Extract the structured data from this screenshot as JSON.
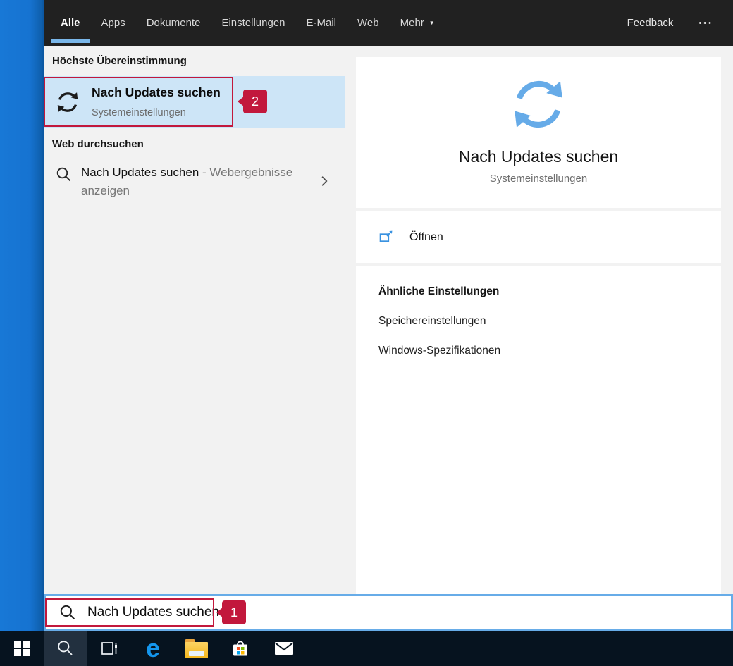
{
  "topbar": {
    "tabs": [
      {
        "label": "Alle",
        "active": true
      },
      {
        "label": "Apps"
      },
      {
        "label": "Dokumente"
      },
      {
        "label": "Einstellungen"
      },
      {
        "label": "E-Mail"
      },
      {
        "label": "Web"
      }
    ],
    "more": {
      "label": "Mehr",
      "caret_icon": "▼"
    },
    "feedback_label": "Feedback",
    "overflow_label": "•••"
  },
  "left_panel": {
    "best_match_header": "Höchste Übereinstimmung",
    "best_match": {
      "title": "Nach Updates suchen",
      "subtitle": "Systemeinstellungen",
      "icon": "sync-icon"
    },
    "web_header": "Web durchsuchen",
    "web_result": {
      "query": "Nach Updates suchen",
      "suffix_gray": " - Webergebnisse anzeigen",
      "icon": "search-icon"
    }
  },
  "preview": {
    "icon": "sync-icon",
    "title": "Nach Updates suchen",
    "subtitle": "Systemeinstellungen",
    "open_label": "Öffnen",
    "open_icon": "open-external-icon",
    "related_header": "Ähnliche Einstellungen",
    "related": [
      {
        "label": "Speichereinstellungen"
      },
      {
        "label": "Windows-Spezifikationen"
      }
    ]
  },
  "search_bar": {
    "value": "Nach Updates suchen",
    "icon": "search-icon"
  },
  "annotations": {
    "step1": "1",
    "step2": "2",
    "color": "#c2183c"
  },
  "taskbar": {
    "buttons": [
      {
        "name": "start",
        "icon": "windows-logo-icon"
      },
      {
        "name": "search",
        "icon": "search-icon",
        "active": true
      },
      {
        "name": "task-view",
        "icon": "task-view-icon"
      },
      {
        "name": "edge",
        "icon": "edge-icon",
        "glyph": "e"
      },
      {
        "name": "file-explorer",
        "icon": "folder-icon"
      },
      {
        "name": "store",
        "icon": "store-bag-icon"
      },
      {
        "name": "mail",
        "icon": "mail-envelope-icon"
      }
    ]
  },
  "colors": {
    "selection_blue": "#cde5f7",
    "accent_border_blue": "#67ace8",
    "tab_underline_blue": "#7ab7ea",
    "sync_icon_blue": "#66abe8",
    "annotation_red": "#c2183c",
    "topbar_bg": "#212121",
    "taskbar_bg": "#06131f",
    "desktop_blue": "#1673d1"
  }
}
